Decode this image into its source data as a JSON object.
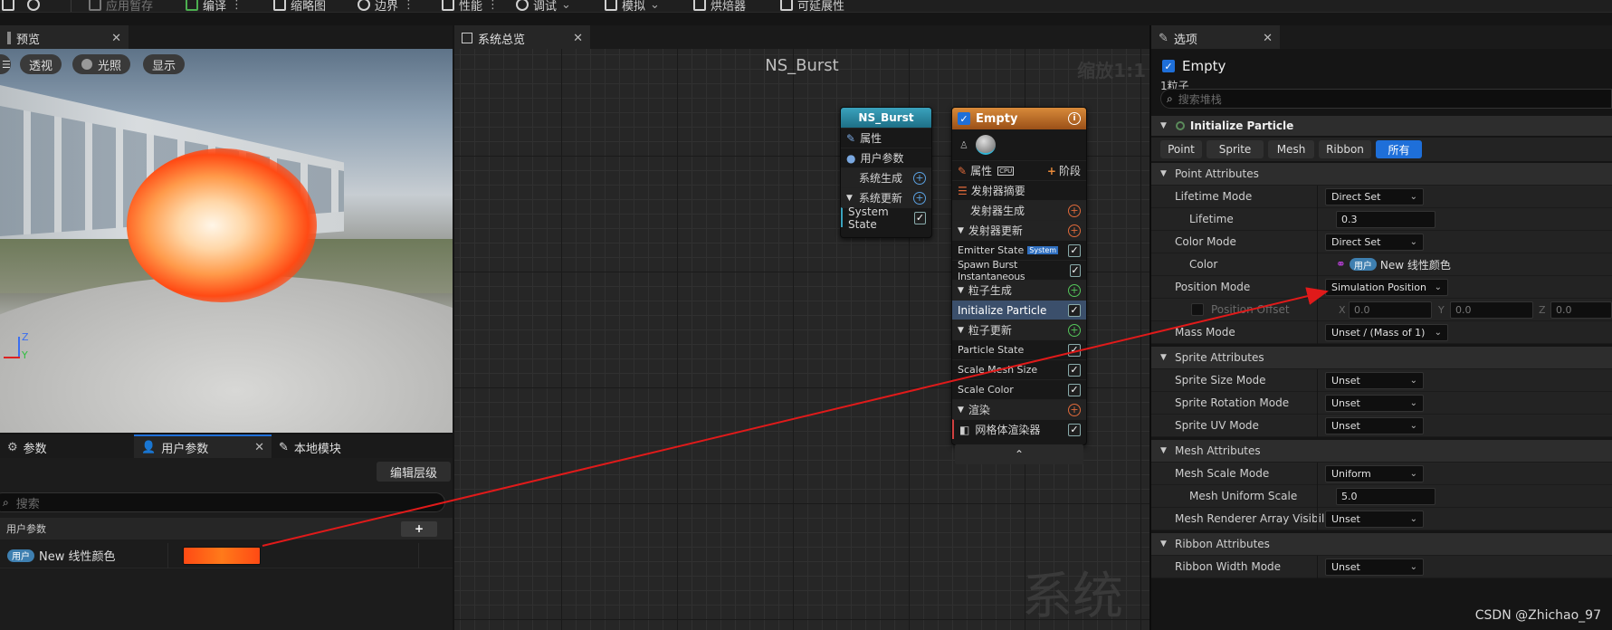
{
  "toolbar": {
    "apply": "应用暂存",
    "compile": "编译",
    "thumbnail": "缩略图",
    "bounds": "边界",
    "performance": "性能",
    "debug": "调试",
    "simulation": "模拟",
    "baker": "烘焙器",
    "scalability": "可延展性"
  },
  "preview": {
    "tab": "预览",
    "btn_perspective": "透视",
    "btn_lighting": "光照",
    "btn_show": "显示",
    "axis_z": "Z",
    "axis_y": "Y"
  },
  "params": {
    "tab_params": "参数",
    "tab_user_params": "用户参数",
    "tab_local_modules": "本地模块",
    "edit_hierarchy": "编辑层级",
    "search_placeholder": "搜索",
    "section_label": "用户参数",
    "add_symbol": "+",
    "param_tag": "用户",
    "param_name": "New 线性颜色",
    "param_color_start": "#ff4a14",
    "param_color_end": "#ff7a1a"
  },
  "graph": {
    "tab": "系统总览",
    "title": "NS_Burst",
    "zoom": "缩放1:1",
    "watermark": "系统",
    "system_node": {
      "title": "NS_Burst",
      "rows": [
        "属性",
        "用户参数",
        "系统生成",
        "系统更新",
        "System State"
      ]
    },
    "emitter_node": {
      "title": "Empty",
      "props_label": "属性",
      "cpu_badge": "CPU",
      "stage_button": "阶段",
      "emitter_summary": "发射器摘要",
      "emitter_spawn": "发射器生成",
      "emitter_update": "发射器更新",
      "emitter_state": "Emitter State",
      "system_badge": "System",
      "spawn_burst": "Spawn Burst Instantaneous",
      "particle_spawn": "粒子生成",
      "initialize_particle": "Initialize Particle",
      "particle_update": "粒子更新",
      "particle_state": "Particle State",
      "scale_mesh_size": "Scale Mesh Size",
      "scale_color": "Scale Color",
      "render": "渲染",
      "mesh_renderer": "网格体渲染器",
      "collapse": "⌃"
    }
  },
  "details": {
    "tab": "选项",
    "emitter_name": "Empty",
    "particle_count": "1粒子",
    "search_placeholder": "搜索堆栈",
    "module_title": "Initialize Particle",
    "filters": [
      "Point",
      "Sprite",
      "Mesh",
      "Ribbon",
      "所有"
    ],
    "rows": {
      "point_attributes": "Point Attributes",
      "lifetime_mode": "Lifetime Mode",
      "lifetime_mode_value": "Direct Set",
      "lifetime": "Lifetime",
      "lifetime_value": "0.3",
      "color_mode": "Color Mode",
      "color_mode_value": "Direct Set",
      "color": "Color",
      "color_tag": "用户",
      "color_value": "New 线性颜色",
      "position_mode": "Position Mode",
      "position_mode_value": "Simulation Position",
      "position_offset": "Position Offset",
      "x_label": "X",
      "x_value": "0.0",
      "y_label": "Y",
      "y_value": "0.0",
      "z_label": "Z",
      "z_value": "0.0",
      "mass_mode": "Mass Mode",
      "mass_mode_value": "Unset / (Mass of 1)",
      "sprite_attributes": "Sprite Attributes",
      "sprite_size_mode": "Sprite Size Mode",
      "sprite_size_mode_value": "Unset",
      "sprite_rotation_mode": "Sprite Rotation Mode",
      "sprite_rotation_mode_value": "Unset",
      "sprite_uv_mode": "Sprite UV Mode",
      "sprite_uv_mode_value": "Unset",
      "mesh_attributes": "Mesh Attributes",
      "mesh_scale_mode": "Mesh Scale Mode",
      "mesh_scale_mode_value": "Uniform",
      "mesh_uniform_scale": "Mesh Uniform Scale",
      "mesh_uniform_scale_value": "5.0",
      "mesh_renderer_array_visibility": "Mesh Renderer Array Visibility",
      "mesh_renderer_array_visibility_value": "Unset",
      "ribbon_attributes": "Ribbon Attributes",
      "ribbon_width_mode": "Ribbon Width Mode",
      "ribbon_width_mode_value": "Unset"
    }
  },
  "watermark": "CSDN @Zhichao_97",
  "colors": {
    "accent_blue": "#1e6fd9",
    "system_node": "#2a8fa8",
    "emitter_node": "#c8762a",
    "annotation_arrow": "#e01a1a"
  }
}
